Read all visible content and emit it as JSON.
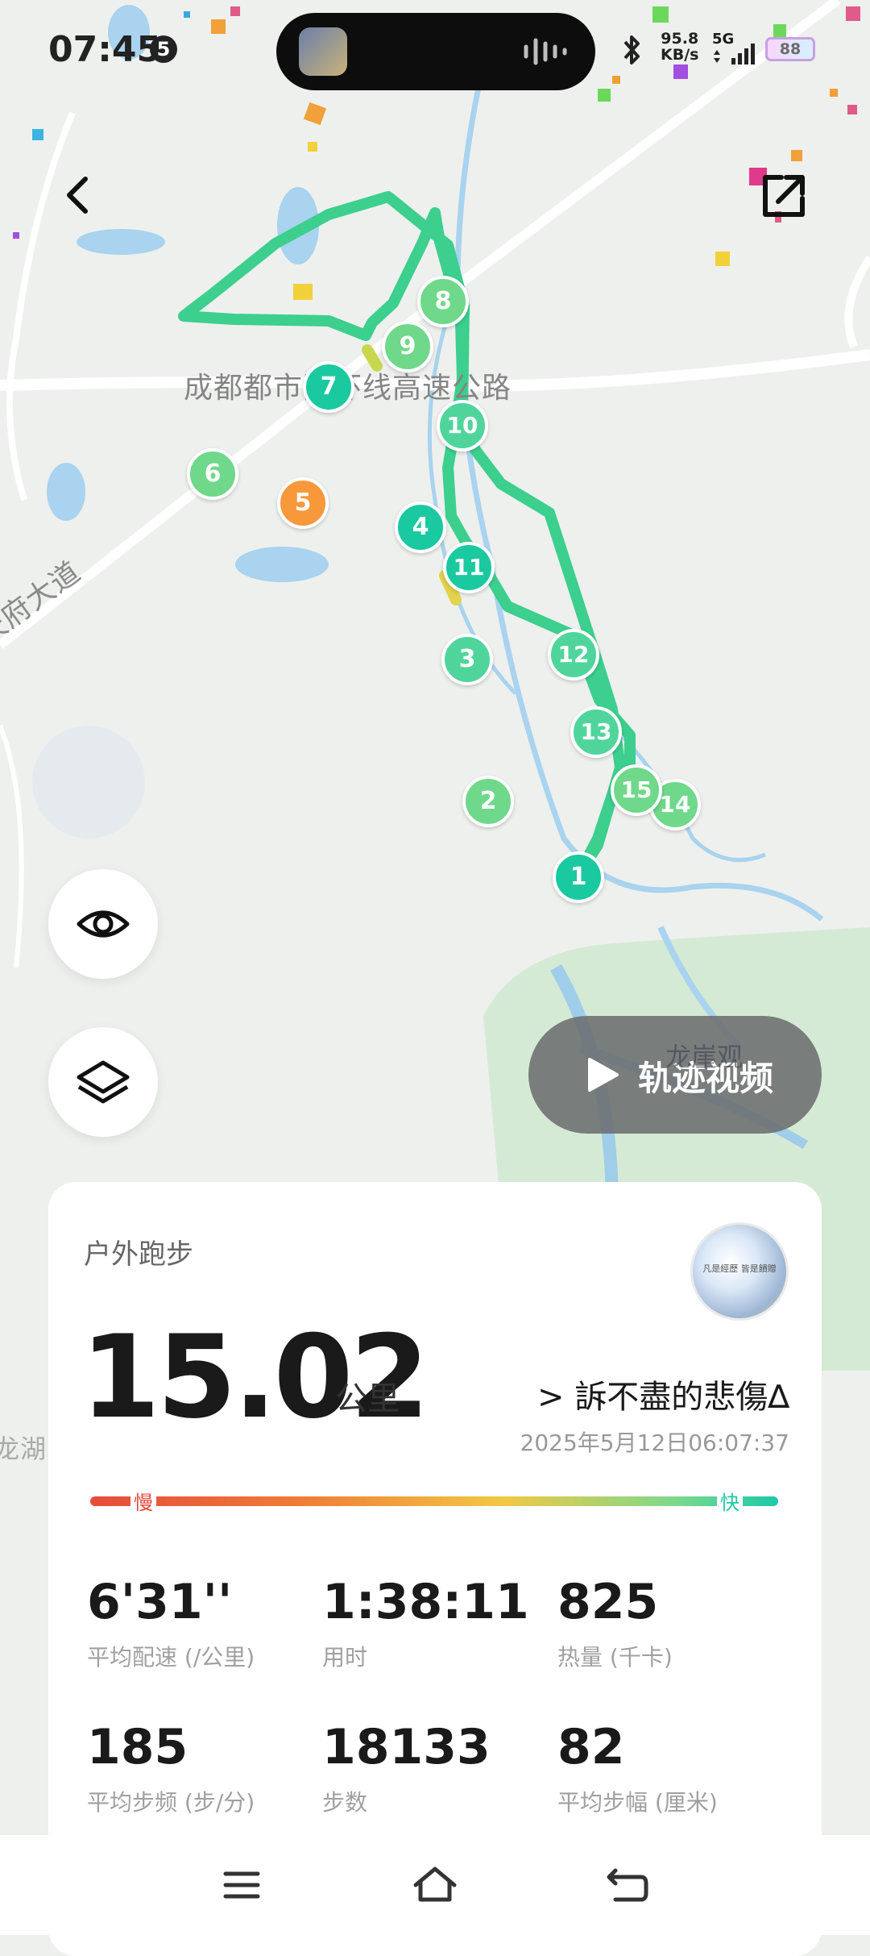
{
  "status_bar": {
    "time": "07:45",
    "notification_count": "5",
    "net_speed_value": "95.8",
    "net_speed_unit": "KB/s",
    "network": "5G",
    "battery": "88"
  },
  "map": {
    "labels": {
      "highway": "成都都市圈环线高速公路",
      "road": "天府大道",
      "place": "龙崖观",
      "edge": "龙湖"
    },
    "markers": [
      "1",
      "2",
      "3",
      "4",
      "5",
      "6",
      "7",
      "8",
      "9",
      "10",
      "11",
      "12",
      "13",
      "14",
      "15"
    ],
    "colors": {
      "route": "#3ccf8e",
      "water": "#a9d3ee",
      "park": "#d5ead5"
    }
  },
  "controls": {
    "visibility_icon": "eye-icon",
    "layers_icon": "layers-icon",
    "video_button": "轨迹视频"
  },
  "summary": {
    "activity_type": "户外跑步",
    "distance": "15.02",
    "distance_unit": "公里",
    "username": "> 訴不盡的悲傷∆",
    "datetime": "2025年5月12日06:07:37",
    "pace_slow": "慢",
    "pace_fast": "快",
    "avatar_text": "凡是經歷 皆是饋贈"
  },
  "stats": [
    {
      "value": "6'31''",
      "label": "平均配速 (/公里)"
    },
    {
      "value": "1:38:11",
      "label": "用时"
    },
    {
      "value": "825",
      "label": "热量 (千卡)"
    },
    {
      "value": "185",
      "label": "平均步频 (步/分)"
    },
    {
      "value": "18133",
      "label": "步数"
    },
    {
      "value": "82",
      "label": "平均步幅 (厘米)"
    }
  ],
  "nav": {
    "menu_icon": "menu-icon",
    "home_icon": "home-icon",
    "back_icon": "back-icon"
  }
}
